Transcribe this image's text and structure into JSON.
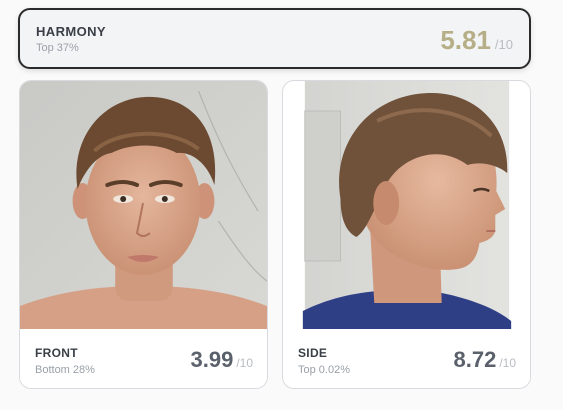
{
  "harmony": {
    "label": "HARMONY",
    "percentile": "Top 37%",
    "score": "5.81",
    "out_of": "/10",
    "score_color": "#b6ae86"
  },
  "front": {
    "label": "FRONT",
    "percentile": "Bottom 28%",
    "score": "3.99",
    "out_of": "/10",
    "photo": "front-face-photo"
  },
  "side": {
    "label": "SIDE",
    "percentile": "Top 0.02%",
    "score": "8.72",
    "out_of": "/10",
    "photo": "side-profile-photo"
  }
}
